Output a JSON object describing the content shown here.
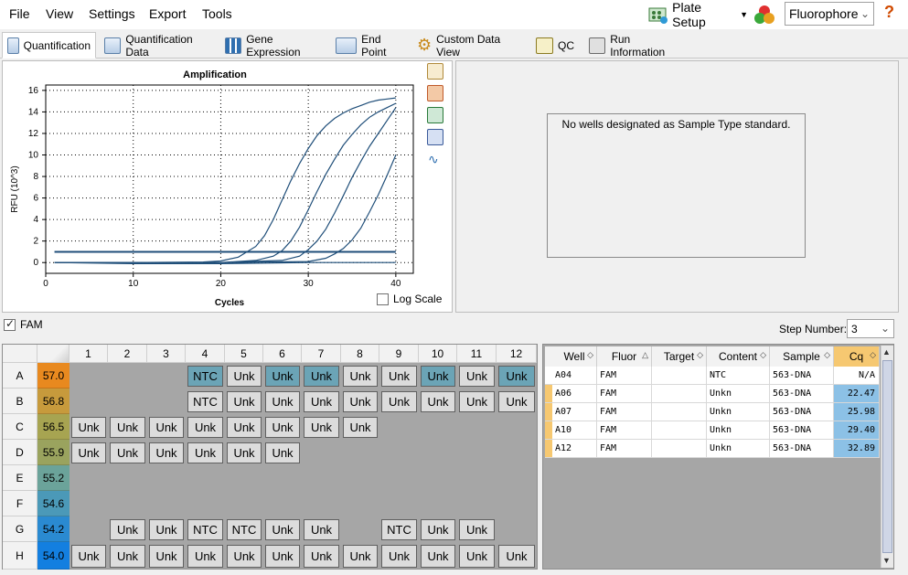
{
  "menu": {
    "file": "File",
    "view": "View",
    "settings": "Settings",
    "export": "Export",
    "tools": "Tools"
  },
  "toolbar": {
    "plate_setup": "Plate Setup",
    "fluorophore": "Fluorophore"
  },
  "tabs": [
    {
      "label": "Quantification",
      "icon": "amplification-chart-icon",
      "active": true
    },
    {
      "label": "Quantification Data",
      "icon": "data-table-icon"
    },
    {
      "label": "Gene Expression",
      "icon": "bar-chart-icon"
    },
    {
      "label": "End Point",
      "icon": "end-point-icon"
    },
    {
      "label": "Custom Data View",
      "icon": "gear-icon"
    },
    {
      "label": "QC",
      "icon": "qc-check-icon"
    },
    {
      "label": "Run Information",
      "icon": "run-info-icon"
    }
  ],
  "chart_data": {
    "type": "line",
    "title": "Amplification",
    "xlabel": "Cycles",
    "ylabel": "RFU (10^3)",
    "xlim": [
      0,
      42
    ],
    "ylim": [
      -1,
      16.5
    ],
    "xticks": [
      0,
      10,
      20,
      30,
      40
    ],
    "yticks": [
      0,
      2,
      4,
      6,
      8,
      10,
      12,
      14,
      16
    ],
    "threshold": 1.0,
    "grid": true,
    "series": [
      {
        "x": [
          1,
          10,
          18,
          20,
          22,
          24,
          25,
          26,
          27,
          28,
          29,
          30,
          31,
          32,
          33,
          34,
          35,
          36,
          37,
          38,
          39,
          40
        ],
        "y": [
          0,
          0,
          0.05,
          0.15,
          0.5,
          1.5,
          2.5,
          4,
          5.8,
          7.6,
          9.2,
          10.6,
          11.8,
          12.7,
          13.4,
          13.9,
          14.3,
          14.6,
          14.9,
          15.1,
          15.2,
          15.3
        ]
      },
      {
        "x": [
          1,
          10,
          20,
          24,
          26,
          27,
          28,
          29,
          30,
          31,
          32,
          33,
          34,
          35,
          36,
          37,
          38,
          39,
          40
        ],
        "y": [
          0,
          0,
          0,
          0.2,
          0.6,
          1.1,
          2.0,
          3.3,
          4.9,
          6.6,
          8.2,
          9.6,
          10.9,
          11.9,
          12.8,
          13.5,
          14.0,
          14.4,
          14.8
        ]
      },
      {
        "x": [
          1,
          10,
          20,
          27,
          29,
          30,
          31,
          32,
          33,
          34,
          35,
          36,
          37,
          38,
          39,
          40
        ],
        "y": [
          0,
          0,
          0,
          0.2,
          0.6,
          1.2,
          2.0,
          3.1,
          4.6,
          6.2,
          7.9,
          9.4,
          10.8,
          12.0,
          13.2,
          14.4
        ]
      },
      {
        "x": [
          1,
          10,
          20,
          30,
          32,
          33,
          34,
          35,
          36,
          37,
          38,
          39,
          40
        ],
        "y": [
          0,
          0,
          0,
          0.1,
          0.4,
          0.8,
          1.3,
          2.1,
          3.2,
          4.7,
          6.3,
          8.1,
          10.0
        ]
      },
      {
        "x": [
          1,
          10,
          20,
          30,
          40
        ],
        "y": [
          0,
          -0.1,
          -0.1,
          0,
          0
        ]
      }
    ]
  },
  "log_scale": {
    "label": "Log Scale",
    "checked": false
  },
  "standard_curve": {
    "message": "No wells designated as Sample Type standard."
  },
  "fluor_filter": {
    "label": "FAM",
    "checked": true
  },
  "step": {
    "label": "Step Number:",
    "value": "3"
  },
  "plate": {
    "columns": [
      "1",
      "2",
      "3",
      "4",
      "5",
      "6",
      "7",
      "8",
      "9",
      "10",
      "11",
      "12"
    ],
    "rows": [
      {
        "label": "A",
        "temp": "57.0",
        "temp_color": "#e8891f",
        "wells": [
          "",
          "",
          "",
          "NTC",
          "Unk",
          "Unk",
          "Unk",
          "Unk",
          "Unk",
          "Unk",
          "Unk",
          "Unk"
        ],
        "blue": [
          3,
          5,
          6,
          9,
          11
        ]
      },
      {
        "label": "B",
        "temp": "56.8",
        "temp_color": "#c79a3c",
        "wells": [
          "",
          "",
          "",
          "NTC",
          "Unk",
          "Unk",
          "Unk",
          "Unk",
          "Unk",
          "Unk",
          "Unk",
          "Unk"
        ],
        "blue": []
      },
      {
        "label": "C",
        "temp": "56.5",
        "temp_color": "#a7a451",
        "wells": [
          "Unk",
          "Unk",
          "Unk",
          "Unk",
          "Unk",
          "Unk",
          "Unk",
          "Unk",
          "",
          "",
          "",
          ""
        ],
        "blue": []
      },
      {
        "label": "D",
        "temp": "55.9",
        "temp_color": "#9aa35e",
        "wells": [
          "Unk",
          "Unk",
          "Unk",
          "Unk",
          "Unk",
          "Unk",
          "",
          "",
          "",
          "",
          "",
          ""
        ],
        "blue": []
      },
      {
        "label": "E",
        "temp": "55.2",
        "temp_color": "#6ba39a",
        "wells": [
          "",
          "",
          "",
          "",
          "",
          "",
          "",
          "",
          "",
          "",
          "",
          ""
        ],
        "blue": []
      },
      {
        "label": "F",
        "temp": "54.6",
        "temp_color": "#4b99b8",
        "wells": [
          "",
          "",
          "",
          "",
          "",
          "",
          "",
          "",
          "",
          "",
          "",
          ""
        ],
        "blue": []
      },
      {
        "label": "G",
        "temp": "54.2",
        "temp_color": "#2a8ad1",
        "wells": [
          "",
          "Unk",
          "Unk",
          "NTC",
          "NTC",
          "Unk",
          "Unk",
          "",
          "NTC",
          "Unk",
          "Unk",
          ""
        ],
        "blue": []
      },
      {
        "label": "H",
        "temp": "54.0",
        "temp_color": "#137fe0",
        "wells": [
          "Unk",
          "Unk",
          "Unk",
          "Unk",
          "Unk",
          "Unk",
          "Unk",
          "Unk",
          "Unk",
          "Unk",
          "Unk",
          "Unk"
        ],
        "blue": []
      }
    ]
  },
  "results": {
    "headers": [
      "Well",
      "Fluor",
      "Target",
      "Content",
      "Sample",
      "Cq"
    ],
    "rows": [
      [
        "A04",
        "FAM",
        "",
        "NTC",
        "563-DNA",
        "N/A"
      ],
      [
        "A06",
        "FAM",
        "",
        "Unkn",
        "563-DNA",
        "22.47"
      ],
      [
        "A07",
        "FAM",
        "",
        "Unkn",
        "563-DNA",
        "25.98"
      ],
      [
        "A10",
        "FAM",
        "",
        "Unkn",
        "563-DNA",
        "29.40"
      ],
      [
        "A12",
        "FAM",
        "",
        "Unkn",
        "563-DNA",
        "32.89"
      ]
    ]
  },
  "colors": {
    "curve": "#1f4e79",
    "cq_highlight": "#8cc1e6",
    "well_selected": "#6ba4b6"
  }
}
